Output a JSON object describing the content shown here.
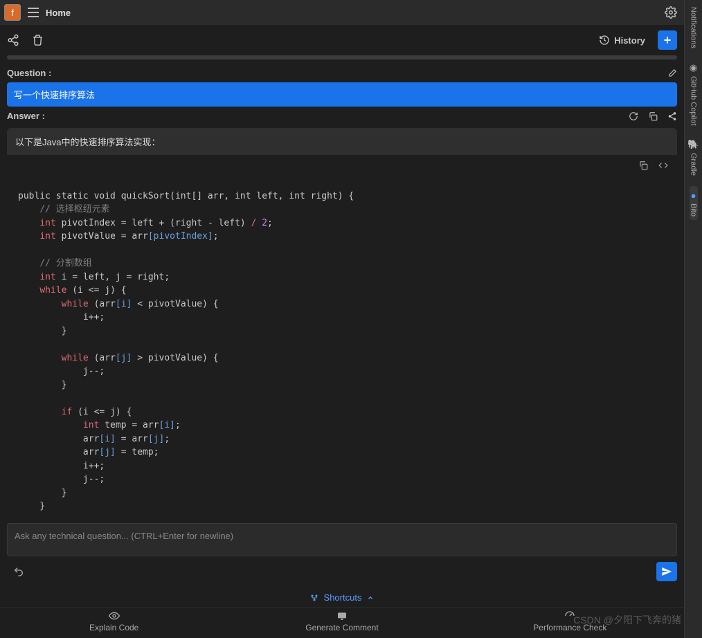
{
  "topbar": {
    "avatar_letter": "f",
    "home_label": "Home"
  },
  "toolbar": {
    "history_label": "History"
  },
  "question": {
    "heading": "Question :",
    "text": "写一个快速排序算法"
  },
  "answer": {
    "heading": "Answer :",
    "intro": "以下是Java中的快速排序算法实现：",
    "code_tokens": [
      {
        "t": "\n"
      },
      {
        "t": "public static void quickSort(int[] arr, int left, int right) {\n"
      },
      {
        "t": "    "
      },
      {
        "t": "// 选择枢纽元素\n",
        "c": "cm"
      },
      {
        "t": "    "
      },
      {
        "t": "int ",
        "c": "ty"
      },
      {
        "t": "pivotIndex = left + (right - left) "
      },
      {
        "t": "/",
        "c": "kw"
      },
      {
        "t": " "
      },
      {
        "t": "2",
        "c": "num"
      },
      {
        "t": ";\n"
      },
      {
        "t": "    "
      },
      {
        "t": "int ",
        "c": "ty"
      },
      {
        "t": "pivotValue = arr"
      },
      {
        "t": "[pivotIndex]",
        "c": "idx"
      },
      {
        "t": ";\n"
      },
      {
        "t": "\n"
      },
      {
        "t": "    "
      },
      {
        "t": "// 分割数组\n",
        "c": "cm"
      },
      {
        "t": "    "
      },
      {
        "t": "int ",
        "c": "ty"
      },
      {
        "t": "i = left, j = right;\n"
      },
      {
        "t": "    "
      },
      {
        "t": "while ",
        "c": "kw"
      },
      {
        "t": "(i <= j) {\n"
      },
      {
        "t": "        "
      },
      {
        "t": "while ",
        "c": "kw"
      },
      {
        "t": "(arr"
      },
      {
        "t": "[i]",
        "c": "idx"
      },
      {
        "t": " < pivotValue) {\n"
      },
      {
        "t": "            i++;\n"
      },
      {
        "t": "        }\n"
      },
      {
        "t": "\n"
      },
      {
        "t": "        "
      },
      {
        "t": "while ",
        "c": "kw"
      },
      {
        "t": "(arr"
      },
      {
        "t": "[j]",
        "c": "idx"
      },
      {
        "t": " > pivotValue) {\n"
      },
      {
        "t": "            j--;\n"
      },
      {
        "t": "        }\n"
      },
      {
        "t": "\n"
      },
      {
        "t": "        "
      },
      {
        "t": "if ",
        "c": "kw"
      },
      {
        "t": "(i <= j) {\n"
      },
      {
        "t": "            "
      },
      {
        "t": "int ",
        "c": "ty"
      },
      {
        "t": "temp = arr"
      },
      {
        "t": "[i]",
        "c": "idx"
      },
      {
        "t": ";\n"
      },
      {
        "t": "            arr"
      },
      {
        "t": "[i]",
        "c": "idx"
      },
      {
        "t": " = arr"
      },
      {
        "t": "[j]",
        "c": "idx"
      },
      {
        "t": ";\n"
      },
      {
        "t": "            arr"
      },
      {
        "t": "[j]",
        "c": "idx"
      },
      {
        "t": " = temp;\n"
      },
      {
        "t": "            i++;\n"
      },
      {
        "t": "            j--;\n"
      },
      {
        "t": "        }\n"
      },
      {
        "t": "    }\n"
      }
    ]
  },
  "input": {
    "placeholder": "Ask any technical question... (CTRL+Enter for newline)"
  },
  "shortcuts": {
    "label": "Shortcuts"
  },
  "bottom": {
    "explain": "Explain Code",
    "gencomment": "Generate Comment",
    "perfcheck": "Performance Check"
  },
  "rail": {
    "notifications": "Notifications",
    "copilot": "GitHub Copilot",
    "gradle": "Gradle",
    "bito": "Bito"
  },
  "watermark": "CSDN @夕阳下飞奔的猪"
}
